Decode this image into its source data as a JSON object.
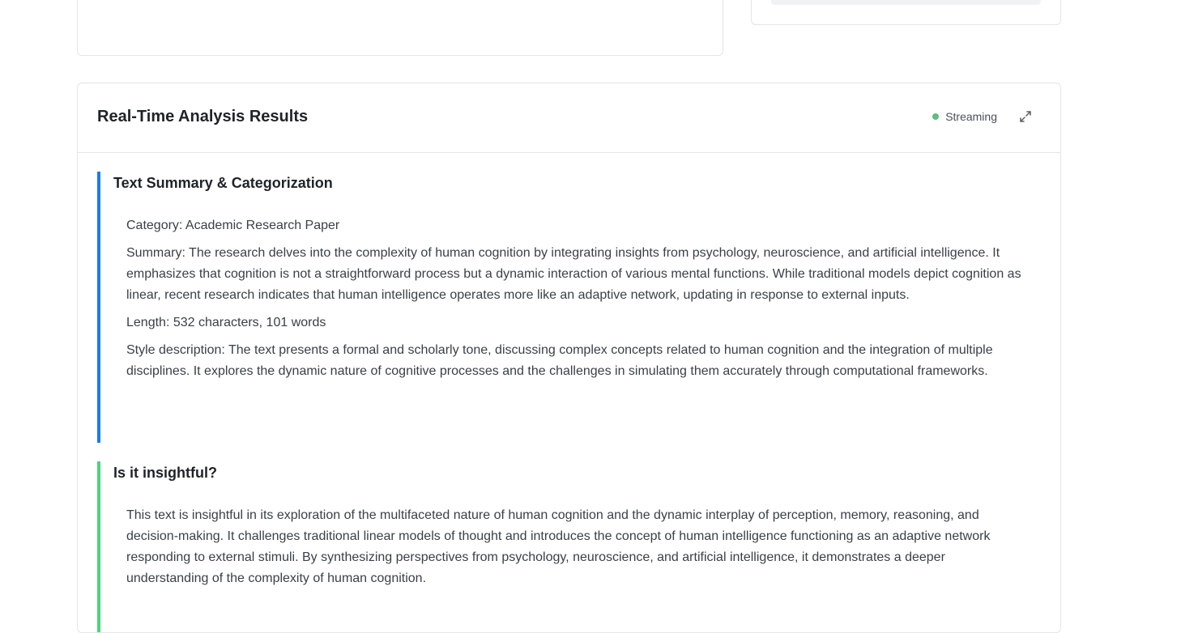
{
  "results": {
    "title": "Real-Time Analysis Results",
    "status": "Streaming",
    "status_color": "#5cbf7a",
    "expand_icon": "expand-icon"
  },
  "sections": [
    {
      "title": "Text Summary & Categorization",
      "accent": "#1a7cf0",
      "paragraphs": [
        "Category: Academic Research Paper",
        "Summary: The research delves into the complexity of human cognition by integrating insights from psychology, neuroscience, and artificial intelligence. It emphasizes that cognition is not a straightforward process but a dynamic interaction of various mental functions. While traditional models depict cognition as linear, recent research indicates that human intelligence operates more like an adaptive network, updating in response to external inputs.",
        "Length: 532 characters, 101 words",
        "Style description: The text presents a formal and scholarly tone, discussing complex concepts related to human cognition and the integration of multiple disciplines. It explores the dynamic nature of cognitive processes and the challenges in simulating them accurately through computational frameworks."
      ]
    },
    {
      "title": "Is it insightful?",
      "accent": "#4cd47a",
      "paragraphs": [
        "This text is insightful in its exploration of the multifaceted nature of human cognition and the dynamic interplay of perception, memory, reasoning, and decision-making. It challenges traditional linear models of thought and introduces the concept of human intelligence functioning as an adaptive network responding to external stimuli. By synthesizing perspectives from psychology, neuroscience, and artificial intelligence, it demonstrates a deeper understanding of the complexity of human cognition."
      ]
    }
  ]
}
